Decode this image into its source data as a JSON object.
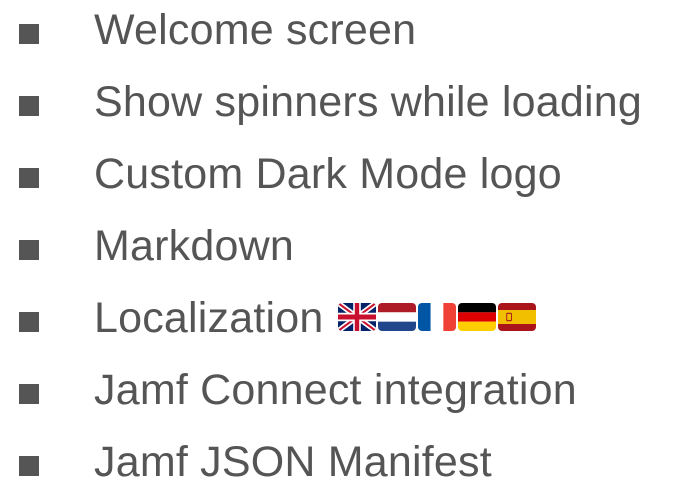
{
  "features": [
    {
      "label": "Welcome screen"
    },
    {
      "label": "Show spinners while loading"
    },
    {
      "label": "Custom Dark Mode logo"
    },
    {
      "label": "Markdown"
    },
    {
      "label": "Localization",
      "flags": [
        "uk-flag-icon",
        "netherlands-flag-icon",
        "france-flag-icon",
        "germany-flag-icon",
        "spain-flag-icon"
      ]
    },
    {
      "label": "Jamf Connect integration"
    },
    {
      "label": "Jamf JSON Manifest"
    }
  ],
  "colors": {
    "text": "#555555",
    "bullet": "#555555",
    "background": "#ffffff"
  }
}
